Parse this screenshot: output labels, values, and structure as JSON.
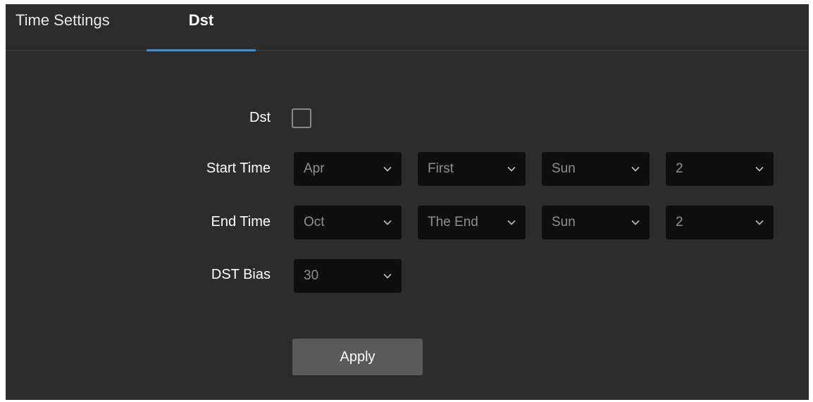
{
  "tabs": [
    {
      "label": "Time Settings",
      "active": false
    },
    {
      "label": "Dst",
      "active": true
    }
  ],
  "colors": {
    "panel_bg": "#2c2c2c",
    "select_bg": "#0f0f0f",
    "active_tab_underline": "#3a8fd9",
    "button_bg": "#5a5a5a"
  },
  "form": {
    "dst": {
      "label": "Dst",
      "checked": false
    },
    "start_time": {
      "label": "Start Time",
      "month": "Apr",
      "week": "First",
      "day": "Sun",
      "hour": "2"
    },
    "end_time": {
      "label": "End Time",
      "month": "Oct",
      "week": "The End",
      "day": "Sun",
      "hour": "2"
    },
    "dst_bias": {
      "label": "DST Bias",
      "value": "30"
    },
    "apply_label": "Apply"
  },
  "icons": {
    "dropdown": "chevron-down-icon"
  }
}
